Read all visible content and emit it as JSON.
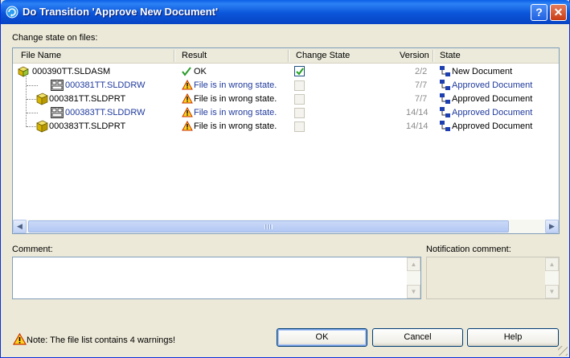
{
  "window": {
    "title": "Do Transition 'Approve New Document'"
  },
  "titlebar_buttons": {
    "help": "?",
    "close": "✕"
  },
  "list": {
    "label": "Change state on files:",
    "columns": [
      "File Name",
      "Result",
      "Change State",
      "Version",
      "State"
    ],
    "rows": [
      {
        "name": "000390TT.SLDASM",
        "icon": "assembly-icon",
        "result": "OK",
        "result_icon": "check-icon",
        "checked": true,
        "enabled": true,
        "version": "2/2",
        "state": "New Document",
        "blue": false
      },
      {
        "name": "000381TT.SLDDRW",
        "icon": "drawing-icon",
        "result": "File is in wrong state.",
        "result_icon": "warning-icon",
        "checked": false,
        "enabled": false,
        "version": "7/7",
        "state": "Approved Document",
        "blue": true
      },
      {
        "name": "000381TT.SLDPRT",
        "icon": "part-icon",
        "result": "File is in wrong state.",
        "result_icon": "warning-icon",
        "checked": false,
        "enabled": false,
        "version": "7/7",
        "state": "Approved Document",
        "blue": false
      },
      {
        "name": "000383TT.SLDDRW",
        "icon": "drawing-icon",
        "result": "File is in wrong state.",
        "result_icon": "warning-icon",
        "checked": false,
        "enabled": false,
        "version": "14/14",
        "state": "Approved Document",
        "blue": true
      },
      {
        "name": "000383TT.SLDPRT",
        "icon": "part-icon",
        "result": "File is in wrong state.",
        "result_icon": "warning-icon",
        "checked": false,
        "enabled": false,
        "version": "14/14",
        "state": "Approved Document",
        "blue": false
      }
    ]
  },
  "comment": {
    "label": "Comment:",
    "value": ""
  },
  "notification": {
    "label": "Notification comment:",
    "value": ""
  },
  "note": "Note: The file list contains 4 warnings!",
  "buttons": {
    "ok": "OK",
    "cancel": "Cancel",
    "help": "Help"
  },
  "colors": {
    "title_bar": "#0a55da",
    "link_blue": "#1f3a9c",
    "warning": "#e8b400"
  }
}
